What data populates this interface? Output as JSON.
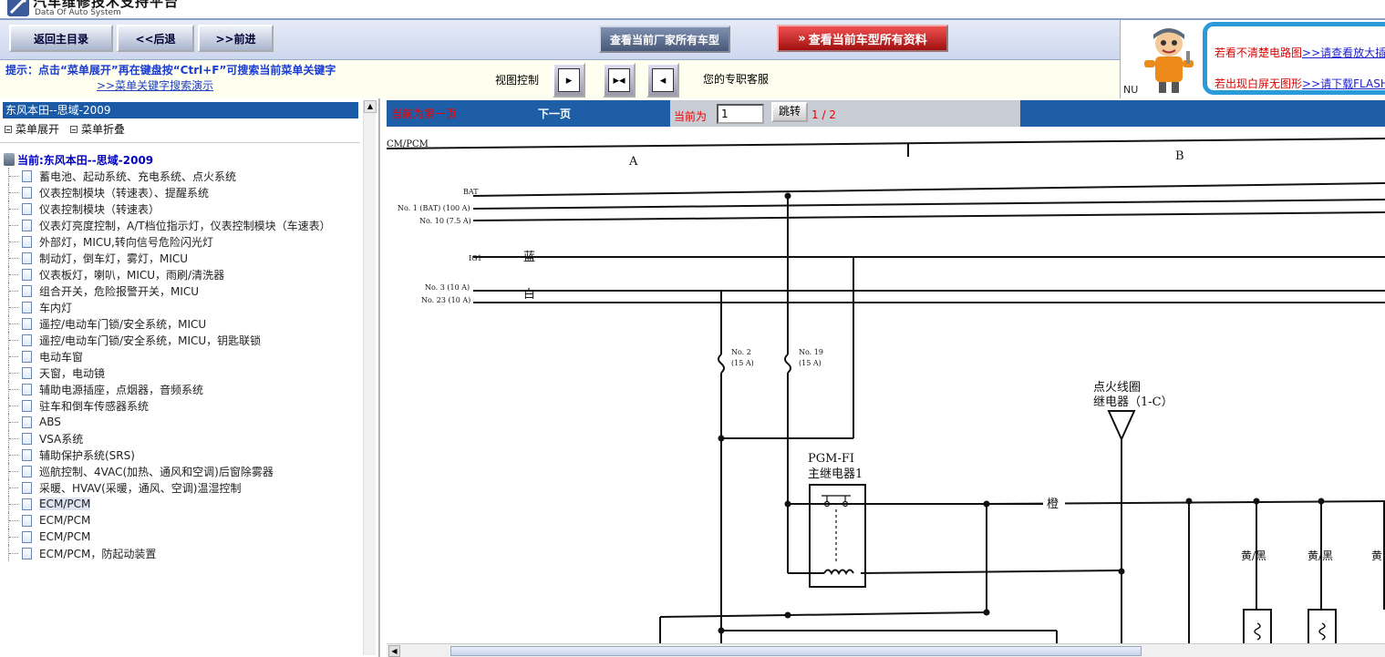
{
  "app": {
    "title": "汽车维修技术支持平台",
    "subtitle": "Data Of Auto System"
  },
  "nav": {
    "home": "返回主目录",
    "back": "<<后退",
    "forward": ">>前进",
    "all_models": "查看当前厂家所有车型",
    "all_data": "查看当前车型所有资料"
  },
  "hint": {
    "line1": "提示：点击“菜单展开”再在键盘按“Ctrl+F”可搜索当前菜单关键字",
    "link": ">>菜单关键字搜索演示",
    "view_label": "视图控制",
    "service": "您的专职客服"
  },
  "promo": {
    "nu": "NU",
    "tip1_text": "若看不清楚电路图",
    "tip1_link": ">>请查看放大插件",
    "tip2_text": "若出现白屏无图形",
    "tip2_link": ">>请下载FLASH"
  },
  "sidebar": {
    "title": "东风本田--思域-2009",
    "expand": "菜单展开",
    "collapse": "菜单折叠",
    "root": "当前:东风本田--思域-2009",
    "items": [
      "蓄电池、起动系统、充电系统、点火系统",
      "仪表控制模块（转速表）、提醒系统",
      "仪表控制模块（转速表）",
      "仪表灯亮度控制，A/T档位指示灯，仪表控制模块（车速表）",
      "外部灯，MICU,转向信号危险闪光灯",
      "制动灯，倒车灯，雾灯，MICU",
      "仪表板灯，喇叭，MICU，雨刷/清洗器",
      "组合开关，危险报警开关，MICU",
      "车内灯",
      "遥控/电动车门锁/安全系统，MICU",
      "遥控/电动车门锁/安全系统，MICU，钥匙联锁",
      "电动车窗",
      "天窗，电动镜",
      "辅助电源插座，点烟器，音频系统",
      "驻车和倒车传感器系统",
      "ABS",
      "VSA系统",
      "辅助保护系统(SRS)",
      "巡航控制、4VAC(加热、通风和空调)后窗除雾器",
      "采暖、HVAV(采暖，通风、空调)温湿控制",
      "ECM/PCM",
      "ECM/PCM",
      "ECM/PCM",
      "ECM/PCM，防起动装置"
    ],
    "selected_index": 20
  },
  "pager": {
    "first": "当前为第一页",
    "next": "下一页",
    "current_label": "当前为",
    "current_value": "1",
    "jump": "跳转",
    "total": "1 / 2"
  },
  "diagram": {
    "header": "CM/PCM",
    "col_a": "A",
    "col_b": "B",
    "bat": "BAT",
    "no1": "No. 1 (BAT) (100 A)",
    "no10": "No. 10 (7.5 A)",
    "ig1": "IG1",
    "blue": "蓝",
    "no3": "No. 3 (10 A)",
    "no23": "No. 23 (10 A)",
    "white": "白",
    "fuse2_a": "No. 2",
    "fuse2_b": "(15 A)",
    "fuse19_a": "No. 19",
    "fuse19_b": "(15 A)",
    "ign_line1": "点火线圈",
    "ign_line2": "继电器（1-C）",
    "pgm_line1": "PGM-FI",
    "pgm_line2": "主继电器1",
    "orange": "橙",
    "yb1": "黄/黑",
    "yb2": "黄/黑",
    "yb3": "黄"
  }
}
